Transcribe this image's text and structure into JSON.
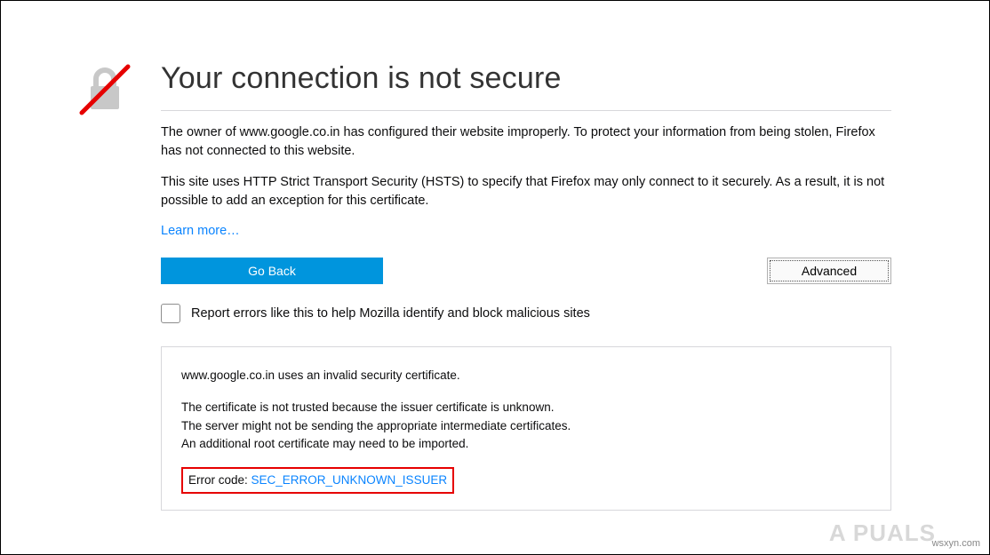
{
  "title": "Your connection is not secure",
  "desc1": "The owner of www.google.co.in has configured their website improperly. To protect your information from being stolen, Firefox has not connected to this website.",
  "desc2": "This site uses HTTP Strict Transport Security (HSTS) to specify that Firefox may only connect to it securely. As a result, it is not possible to add an exception for this certificate.",
  "learn_more": "Learn more…",
  "buttons": {
    "go_back": "Go Back",
    "advanced": "Advanced"
  },
  "report_label": "Report errors like this to help Mozilla identify and block malicious sites",
  "details": {
    "line1": "www.google.co.in uses an invalid security certificate.",
    "line2": "The certificate is not trusted because the issuer certificate is unknown.",
    "line3": "The server might not be sending the appropriate intermediate certificates.",
    "line4": "An additional root certificate may need to be imported.",
    "error_label": "Error code: ",
    "error_code": "SEC_ERROR_UNKNOWN_ISSUER"
  },
  "brand": "A  PUALS",
  "watermark": "wsxyn.com"
}
